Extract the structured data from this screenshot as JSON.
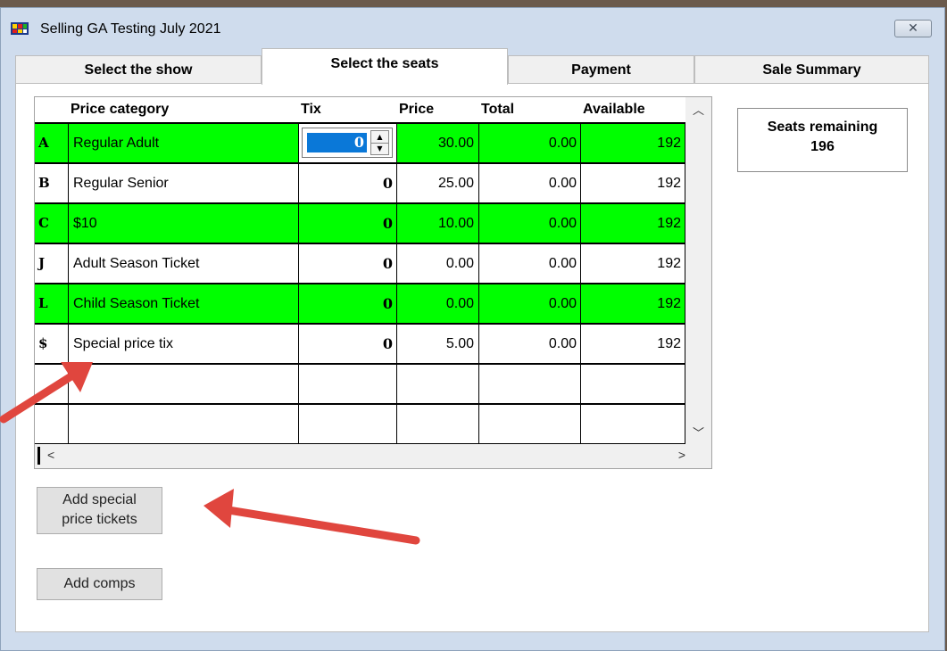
{
  "window": {
    "title": "Selling GA Testing July 2021",
    "close_symbol": "✕"
  },
  "tabs": [
    {
      "label": "Select the show",
      "active": false
    },
    {
      "label": "Select the seats",
      "active": true
    },
    {
      "label": "Payment",
      "active": false
    },
    {
      "label": "Sale Summary",
      "active": false
    }
  ],
  "grid": {
    "columns": [
      "Price category",
      "Tix",
      "Price",
      "Total",
      "Available"
    ],
    "rows": [
      {
        "code": "A",
        "category": "Regular Adult",
        "tix": "0",
        "price": "30.00",
        "total": "0.00",
        "available": "192",
        "highlight": true
      },
      {
        "code": "B",
        "category": "Regular Senior",
        "tix": "0",
        "price": "25.00",
        "total": "0.00",
        "available": "192",
        "highlight": false
      },
      {
        "code": "C",
        "category": "$10",
        "tix": "0",
        "price": "10.00",
        "total": "0.00",
        "available": "192",
        "highlight": true
      },
      {
        "code": "J",
        "category": "Adult Season Ticket",
        "tix": "0",
        "price": "0.00",
        "total": "0.00",
        "available": "192",
        "highlight": false
      },
      {
        "code": "L",
        "category": "Child Season Ticket",
        "tix": "0",
        "price": "0.00",
        "total": "0.00",
        "available": "192",
        "highlight": true
      },
      {
        "code": "$",
        "category": "Special price tix",
        "tix": "0",
        "price": "5.00",
        "total": "0.00",
        "available": "192",
        "highlight": false
      }
    ],
    "empty_rows": 2,
    "scroll_glyphs": {
      "up": "︿",
      "down": "﹀",
      "left": "<",
      "right": ">"
    }
  },
  "seats": {
    "label": "Seats remaining",
    "value": "196"
  },
  "buttons": {
    "special_line1": "Add special",
    "special_line2": "price tickets",
    "comps": "Add comps"
  },
  "colors": {
    "highlight": "#00ff00",
    "selection": "#0a78d8",
    "annotation_arrow": "#e0463e"
  }
}
